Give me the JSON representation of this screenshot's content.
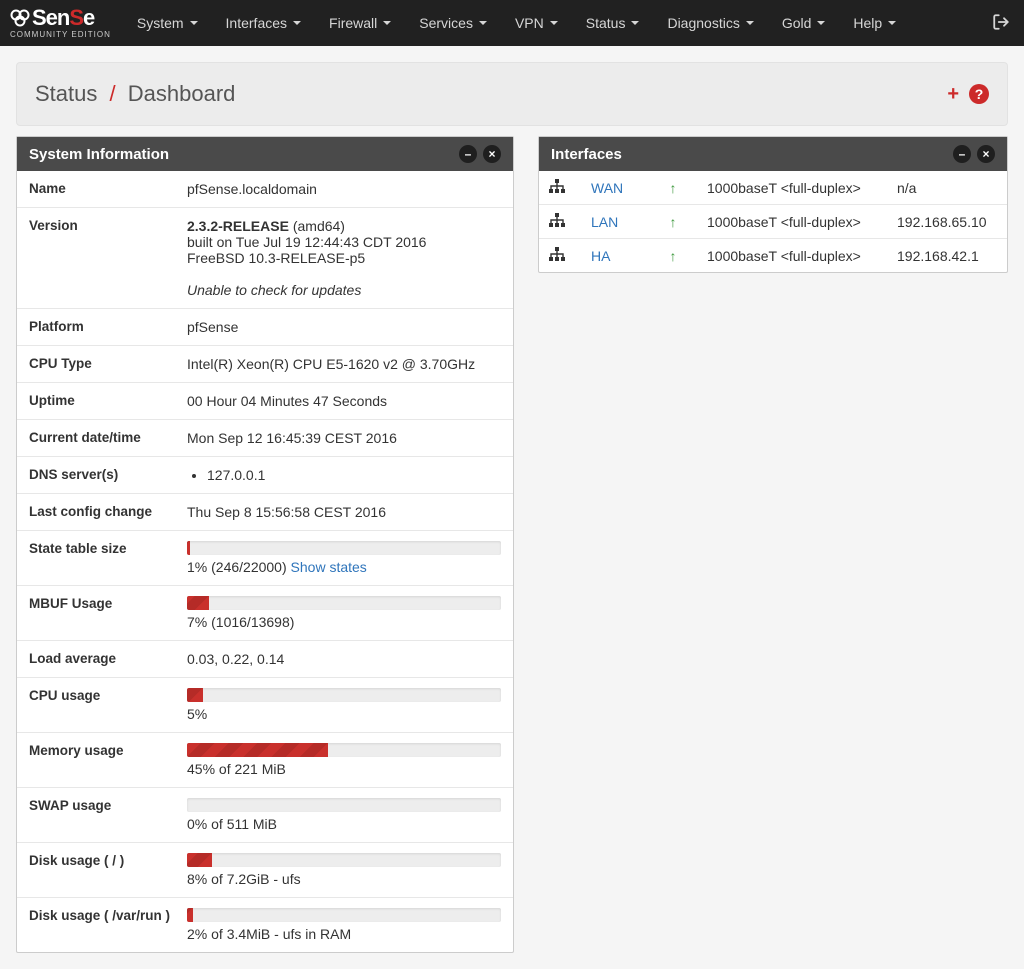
{
  "brand": {
    "name_prefix": "**Sen",
    "name_accent": "S",
    "name_suffix": "e",
    "subtitle": "COMMUNITY EDITION"
  },
  "nav": {
    "items": [
      {
        "label": "System"
      },
      {
        "label": "Interfaces"
      },
      {
        "label": "Firewall"
      },
      {
        "label": "Services"
      },
      {
        "label": "VPN"
      },
      {
        "label": "Status"
      },
      {
        "label": "Diagnostics"
      },
      {
        "label": "Gold"
      },
      {
        "label": "Help"
      }
    ]
  },
  "header": {
    "crumb_status": "Status",
    "crumb_dashboard": "Dashboard"
  },
  "panels": {
    "sysinfo": {
      "title": "System Information",
      "rows": {
        "Name": "pfSense.localdomain",
        "Version": {
          "release": "2.3.2-RELEASE",
          "arch": " (amd64)",
          "built": "built on Tue Jul 19 12:44:43 CDT 2016",
          "os": "FreeBSD 10.3-RELEASE-p5",
          "update_status": "Unable to check for updates"
        },
        "Platform": "pfSense",
        "CPU Type": "Intel(R) Xeon(R) CPU E5-1620 v2 @ 3.70GHz",
        "Uptime": "00 Hour 04 Minutes 47 Seconds",
        "Current date/time": "Mon Sep 12 16:45:39 CEST 2016",
        "DNS server(s)": [
          "127.0.0.1"
        ],
        "Last config change": "Thu Sep 8 15:56:58 CEST 2016",
        "State table size": {
          "pct": 1,
          "text": "1% (246/22000) ",
          "link": "Show states"
        },
        "MBUF Usage": {
          "pct": 7,
          "text": "7% (1016/13698)"
        },
        "Load average": "0.03, 0.22, 0.14",
        "CPU usage": {
          "pct": 5,
          "text": "5%"
        },
        "Memory usage": {
          "pct": 45,
          "text": "45% of 221 MiB"
        },
        "SWAP usage": {
          "pct": 0,
          "text": "0% of 511 MiB"
        },
        "Disk usage ( / )": {
          "pct": 8,
          "text": "8% of 7.2GiB - ufs"
        },
        "Disk usage ( /var/run )": {
          "pct": 2,
          "text": "2% of 3.4MiB - ufs in RAM"
        }
      },
      "labels": {
        "name": "Name",
        "version": "Version",
        "platform": "Platform",
        "cpu_type": "CPU Type",
        "uptime": "Uptime",
        "current_dt": "Current date/time",
        "dns": "DNS server(s)",
        "last_cfg": "Last config change",
        "state_table": "State table size",
        "mbuf": "MBUF Usage",
        "load_avg": "Load average",
        "cpu_usage": "CPU usage",
        "mem_usage": "Memory usage",
        "swap_usage": "SWAP usage",
        "disk_root": "Disk usage ( / )",
        "disk_varrun": "Disk usage ( /var/run )"
      }
    },
    "interfaces": {
      "title": "Interfaces",
      "rows": [
        {
          "name": "WAN",
          "status": "up",
          "media": "1000baseT <full-duplex>",
          "addr": "n/a"
        },
        {
          "name": "LAN",
          "status": "up",
          "media": "1000baseT <full-duplex>",
          "addr": "192.168.65.10"
        },
        {
          "name": "HA",
          "status": "up",
          "media": "1000baseT <full-duplex>",
          "addr": "192.168.42.1"
        }
      ]
    }
  }
}
